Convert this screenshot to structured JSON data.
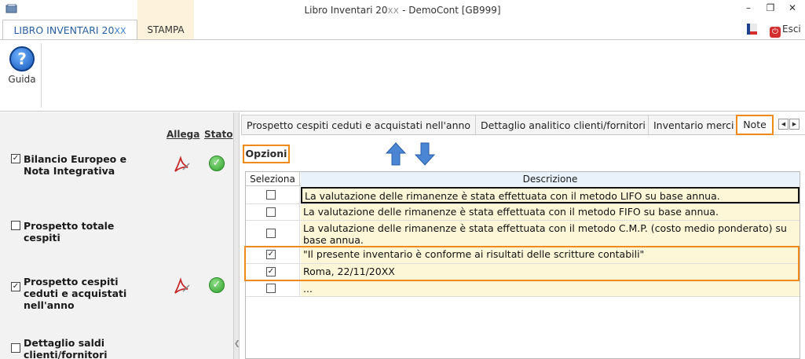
{
  "window": {
    "title": "Libro Inventari 20",
    "title_xx": "XX",
    "title_suffix": " - DemoCont [GB999]",
    "minimize_icon": "minimize-icon",
    "restore_icon": "restore-icon",
    "close_icon": "close-icon"
  },
  "ribbon": {
    "tabs": {
      "libro": "LIBRO INVENTARI 20",
      "libro_xx": "XX",
      "stampa": "STAMPA"
    },
    "guida_label": "Guida",
    "esci_label": "Esci"
  },
  "left_panel": {
    "header_allega": "Allega",
    "header_stato": "Stato",
    "items": [
      {
        "label": "Bilancio Europeo e Nota Integrativa",
        "checked": true,
        "has_pdf": true,
        "status_ok": true
      },
      {
        "label": "Prospetto totale cespiti",
        "checked": false,
        "has_pdf": false,
        "status_ok": false
      },
      {
        "label": "Prospetto cespiti ceduti e acquistati nell'anno",
        "checked": true,
        "has_pdf": true,
        "status_ok": true
      },
      {
        "label": "Dettaglio saldi clienti/fornitori",
        "checked": false,
        "has_pdf": false,
        "status_ok": false
      }
    ]
  },
  "content": {
    "tabs": [
      "Prospetto cespiti ceduti e acquistati nell'anno",
      "Dettaglio analitico clienti/fornitori",
      "Inventario merci",
      "Note"
    ],
    "active_tab": "Note",
    "opzioni_label": "Opzioni",
    "grid": {
      "columns": [
        "Seleziona",
        "Descrizione"
      ],
      "rows": [
        {
          "checked": false,
          "text": "La valutazione delle rimanenze è stata effettuata con il metodo LIFO su base annua."
        },
        {
          "checked": false,
          "text": "La valutazione delle rimanenze è stata effettuata con il metodo FIFO su base annua."
        },
        {
          "checked": false,
          "text": "La valutazione delle rimanenze è stata effettuata con il metodo C.M.P. (costo medio ponderato) su base annua."
        },
        {
          "checked": true,
          "text": "\"Il presente inventario è conforme ai risultati delle scritture contabili\""
        },
        {
          "checked": true,
          "text": "Roma,  22/11/20XX"
        },
        {
          "checked": false,
          "text": "..."
        }
      ]
    }
  },
  "colors": {
    "highlight_orange": "#f08a1c",
    "row_yellow": "#fdf7d8",
    "ribbon_blue_text": "#2a5f9e"
  }
}
